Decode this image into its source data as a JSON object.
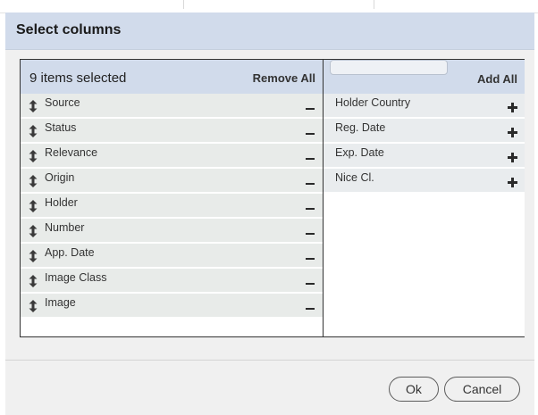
{
  "dialog": {
    "title": "Select columns"
  },
  "selected": {
    "count_label": "9 items selected",
    "remove_all_label": "Remove All",
    "items": [
      {
        "label": "Source"
      },
      {
        "label": "Status"
      },
      {
        "label": "Relevance"
      },
      {
        "label": "Origin"
      },
      {
        "label": "Holder"
      },
      {
        "label": "Number"
      },
      {
        "label": "App. Date"
      },
      {
        "label": "Image Class"
      },
      {
        "label": "Image"
      }
    ]
  },
  "available": {
    "filter_value": "",
    "add_all_label": "Add All",
    "items": [
      {
        "label": "Holder Country"
      },
      {
        "label": "Reg. Date"
      },
      {
        "label": "Exp. Date"
      },
      {
        "label": "Nice Cl."
      }
    ]
  },
  "footer": {
    "ok_label": "Ok",
    "cancel_label": "Cancel"
  },
  "icons": {
    "drag": "up-down-arrow-icon",
    "remove": "minus-icon",
    "add": "plus-icon"
  }
}
